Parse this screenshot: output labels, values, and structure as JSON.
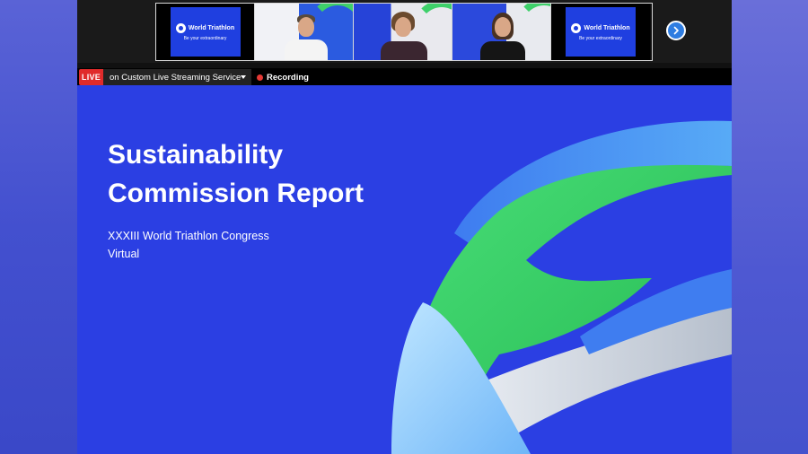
{
  "filmstrip": {
    "tiles": [
      {
        "kind": "brand",
        "brand_name": "World Triathlon",
        "tagline": "Be your extraordinary"
      },
      {
        "kind": "participant"
      },
      {
        "kind": "participant"
      },
      {
        "kind": "participant"
      },
      {
        "kind": "brand",
        "brand_name": "World Triathlon",
        "tagline": "Be your extraordinary"
      }
    ],
    "next_icon": "chevron-right-icon"
  },
  "status_bar": {
    "live_label": "LIVE",
    "stream_target": "on Custom Live Streaming Service",
    "recording_label": "Recording"
  },
  "slide": {
    "title_lines": [
      "Sustainability",
      "Commission Report"
    ],
    "subtitle_lines": [
      "XXXIII World Triathlon Congress",
      "Virtual"
    ],
    "colors": {
      "background": "#2b3fe3",
      "green": "#3ed46a",
      "light_blue": "#5aa0f0",
      "white": "#ffffff"
    }
  },
  "colors": {
    "live_red": "#e02b2b",
    "recording_dot": "#e53935",
    "next_button": "#2f7de1"
  }
}
